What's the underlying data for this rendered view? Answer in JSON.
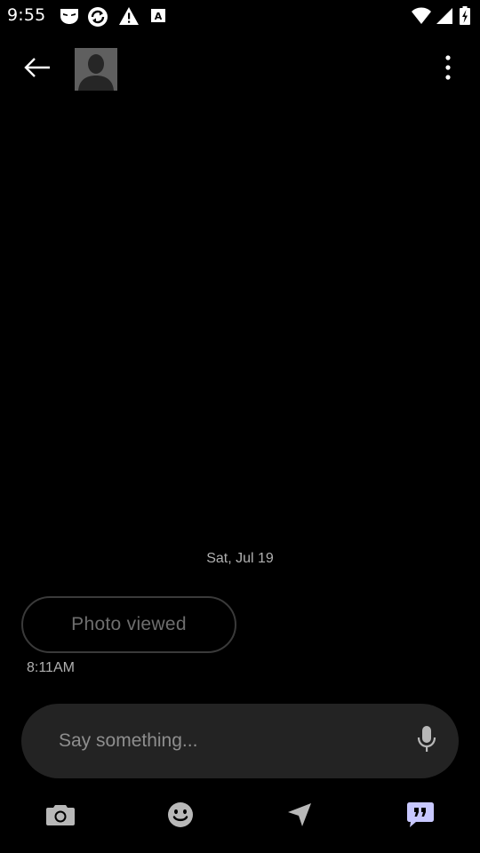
{
  "status_bar": {
    "time": "9:55",
    "icons": [
      "grindr-mask-icon",
      "sync-icon",
      "warning-icon",
      "a-square-icon",
      "wifi-icon",
      "signal-icon",
      "battery-charging-icon"
    ]
  },
  "header": {
    "back_icon": "arrow-left-icon",
    "avatar_icon": "default-avatar-icon",
    "more_icon": "more-vertical-icon"
  },
  "conversation": {
    "date_separator": "Sat, Jul 19",
    "messages": [
      {
        "type": "photo-status",
        "text": "Photo viewed",
        "time": "8:11AM"
      }
    ]
  },
  "composer": {
    "placeholder": "Say something...",
    "value": "",
    "mic_icon": "microphone-icon"
  },
  "toolbar": {
    "items": [
      {
        "icon": "camera-icon"
      },
      {
        "icon": "smiley-icon"
      },
      {
        "icon": "location-arrow-icon"
      },
      {
        "icon": "quote-chat-icon"
      }
    ]
  },
  "colors": {
    "background": "#000000",
    "composer_bg": "#232323",
    "secondary_text": "#b0b0b0",
    "muted_text": "#6e6e6e",
    "icon_gray": "#b8b8b8",
    "chat_icon": "#c8c8ff"
  }
}
